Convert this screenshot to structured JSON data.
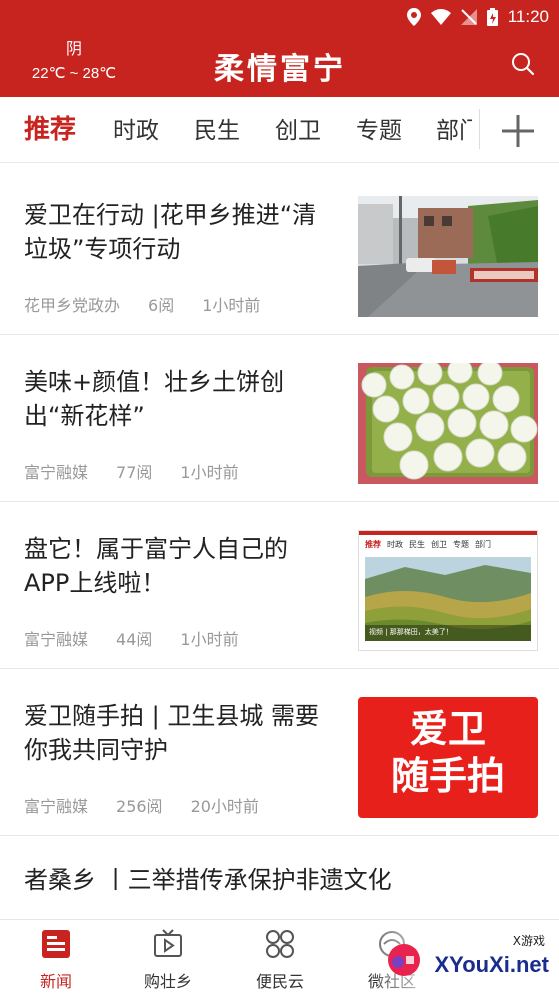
{
  "status": {
    "time": "11:20"
  },
  "header": {
    "weather_condition": "阴",
    "temperature": "22℃ ~ 28℃",
    "app_title": "柔情富宁"
  },
  "tabs": [
    {
      "label": "推荐",
      "active": true
    },
    {
      "label": "时政"
    },
    {
      "label": "民生"
    },
    {
      "label": "创卫"
    },
    {
      "label": "专题"
    },
    {
      "label": "部门"
    }
  ],
  "news": [
    {
      "title": "爱卫在行动 |花甲乡推进“清垃圾”专项行动",
      "source": "花甲乡党政办",
      "reads": "6阅",
      "time": "1小时前"
    },
    {
      "title": "美味+颜值！壮乡土饼创出“新花样”",
      "source": "富宁融媒",
      "reads": "77阅",
      "time": "1小时前"
    },
    {
      "title": "盘它！属于富宁人自己的APP上线啦！",
      "source": "富宁融媒",
      "reads": "44阅",
      "time": "1小时前"
    },
    {
      "title": "爱卫随手拍 | 卫生县城 需要你我共同守护",
      "source": "富宁融媒",
      "reads": "256阅",
      "time": "20小时前"
    }
  ],
  "thumb3": {
    "tabs": [
      "推荐",
      "时政",
      "民生",
      "创卫",
      "专题",
      "部门"
    ],
    "caption": "视频 | 那那梯田，太美了！"
  },
  "thumb4": {
    "line1": "爱卫",
    "line2": "随手拍"
  },
  "last_title": "者桑乡 丨三举措传承保护非遗文化",
  "bottom_nav": [
    {
      "label": "新闻",
      "icon": "news-icon",
      "active": true
    },
    {
      "label": "购壮乡",
      "icon": "tv-icon"
    },
    {
      "label": "便民云",
      "icon": "grid-icon"
    },
    {
      "label": "微社区",
      "icon": "community-icon"
    }
  ],
  "watermark": {
    "small": "X游戏",
    "main": "XYouXi.net"
  },
  "colors": {
    "brand": "#c8241f",
    "meta": "#999999"
  }
}
